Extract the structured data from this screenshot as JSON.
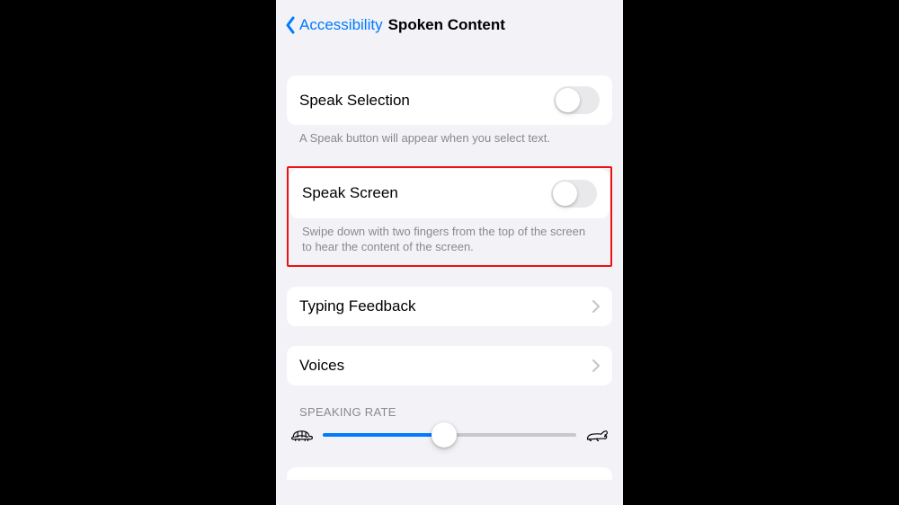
{
  "nav": {
    "back_label": "Accessibility",
    "title": "Spoken Content"
  },
  "rows": {
    "speak_selection": {
      "title": "Speak Selection",
      "footer": "A Speak button will appear when you select text.",
      "on": false
    },
    "speak_screen": {
      "title": "Speak Screen",
      "footer": "Swipe down with two fingers from the top of the screen to hear the content of the screen.",
      "on": false
    },
    "typing_feedback": {
      "title": "Typing Feedback"
    },
    "voices": {
      "title": "Voices"
    }
  },
  "speaking_rate": {
    "header": "SPEAKING RATE",
    "value_percent": 48
  }
}
